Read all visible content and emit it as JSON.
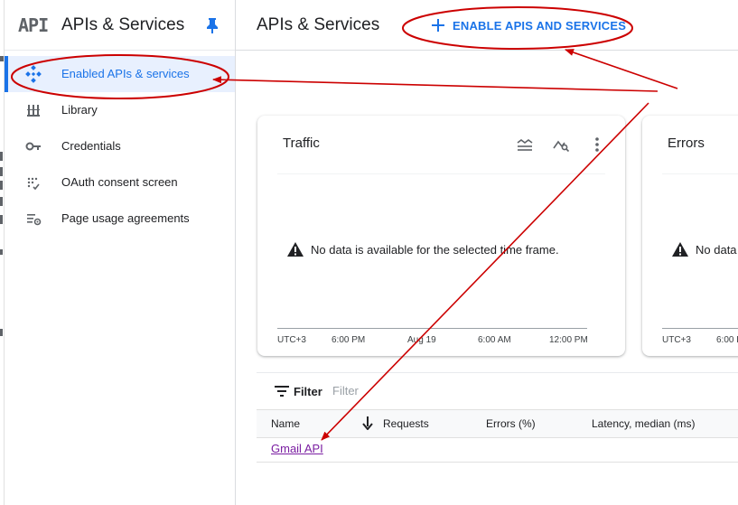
{
  "sidebar": {
    "logo": "API",
    "title": "APIs & Services",
    "items": [
      {
        "label": "Enabled APIs & services",
        "icon": "enabled-apis-icon",
        "active": true
      },
      {
        "label": "Library",
        "icon": "library-icon",
        "active": false
      },
      {
        "label": "Credentials",
        "icon": "key-icon",
        "active": false
      },
      {
        "label": "OAuth consent screen",
        "icon": "oauth-consent-icon",
        "active": false
      },
      {
        "label": "Page usage agreements",
        "icon": "page-usage-settings-icon",
        "active": false
      }
    ]
  },
  "header": {
    "title": "APIs & Services",
    "enable_button": "ENABLE APIS AND SERVICES"
  },
  "cards": {
    "traffic": {
      "title": "Traffic",
      "message": "No data is available for the selected time frame.",
      "ticks": [
        "UTC+3",
        "6:00 PM",
        "Aug 19",
        "6:00 AM",
        "12:00 PM"
      ]
    },
    "errors": {
      "title": "Errors",
      "message": "No data",
      "ticks": [
        "UTC+3",
        "6:00 P"
      ]
    }
  },
  "filter": {
    "label": "Filter",
    "placeholder": "Filter"
  },
  "table": {
    "columns": [
      "Name",
      "Requests",
      "Errors (%)",
      "Latency, median (ms)"
    ],
    "rows": [
      {
        "name": "Gmail API"
      }
    ]
  },
  "colors": {
    "accent": "#1a73e8",
    "annotation": "#cc0000",
    "visited_link": "#7b1fa2"
  }
}
